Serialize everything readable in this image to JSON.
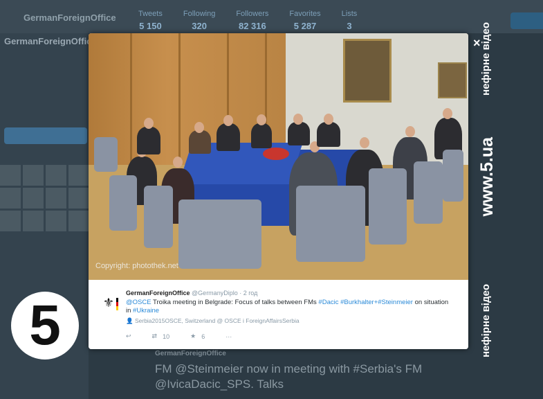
{
  "background": {
    "profile_name": "GermanForeignOffice",
    "stats": [
      {
        "label": "Tweets",
        "value": "5 150"
      },
      {
        "label": "Following",
        "value": "320"
      },
      {
        "label": "Followers",
        "value": "82 316"
      },
      {
        "label": "Favorites",
        "value": "5 287"
      },
      {
        "label": "Lists",
        "value": "3"
      }
    ],
    "second_tweet_author": "GermanForeignOffice",
    "second_tweet_text": "FM @Steinmeier now in meeting with #Serbia's FM @IvicaDacic_SPS. Talks"
  },
  "tweet": {
    "author_name": "GermanForeignOffice",
    "author_handle": "@GermanyDiplo",
    "time": "· 2 год",
    "mention": "@OSCE",
    "text_1": " Troika meeting in Belgrade: Focus of talks between FMs ",
    "tag_dacic": "#Dacic",
    "tag_burkhalter": "#Burkhalter",
    "sep": "+",
    "tag_steinmeier": "#Steinmeier",
    "text_2": " on situation in ",
    "tag_ukraine": "#Ukraine",
    "location": "Serbia2015OSCE, Switzerland @ OSCE i ForeignAffairsSerbia",
    "retweets": "10",
    "favorites": "6",
    "more": "···"
  },
  "photo": {
    "copyright": "Copyright: photothek.net"
  },
  "overlay": {
    "close": "×",
    "watermark_top": "нефірне відео",
    "site": "www.5.ua",
    "watermark_bottom": "нефірне відео",
    "channel_logo": "5"
  }
}
